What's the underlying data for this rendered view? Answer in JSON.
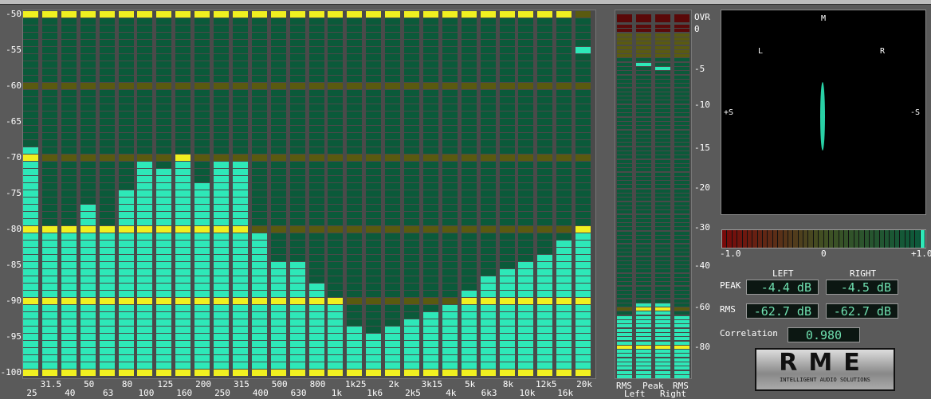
{
  "analyzer": {
    "y_labels": [
      "-50",
      "-55",
      "-60",
      "-65",
      "-70",
      "-75",
      "-80",
      "-85",
      "-90",
      "-95",
      "-100"
    ],
    "bands": [
      "25",
      "31.5",
      "40",
      "50",
      "63",
      "80",
      "100",
      "125",
      "160",
      "200",
      "250",
      "315",
      "400",
      "500",
      "630",
      "800",
      "1k",
      "1k25",
      "1k6",
      "2k",
      "2k5",
      "3k15",
      "4k",
      "5k",
      "6k3",
      "8k",
      "10k",
      "12k5",
      "16k",
      "20k"
    ],
    "levels_db": [
      -69,
      -80,
      -80,
      -77,
      -80,
      -75,
      -71,
      -72,
      -70,
      -74,
      -71,
      -71,
      -81,
      -85,
      -85,
      -88,
      -90,
      -94,
      -95,
      -94,
      -93,
      -92,
      -91,
      -89,
      -87,
      -86,
      -85,
      -84,
      -82,
      -80
    ],
    "peak_hold_db": [
      -50,
      -50,
      -50,
      -50,
      -50,
      -50,
      -50,
      -50,
      -50,
      -50,
      -50,
      -50,
      -50,
      -50,
      -50,
      -50,
      -50,
      -50,
      -50,
      -50,
      -50,
      -50,
      -50,
      -50,
      -50,
      -50,
      -50,
      -50,
      -50,
      -55
    ],
    "range_db": [
      -100,
      -50
    ]
  },
  "meters": {
    "scale": [
      "OVR",
      "0",
      "-5",
      "-10",
      "-15",
      "-20",
      "-30",
      "-40",
      "-60",
      "-80"
    ],
    "columns": [
      {
        "top": "RMS",
        "level_db": -62.7
      },
      {
        "top": "Peak",
        "level_db": -57,
        "peak_hold_db": -4.4
      },
      {
        "top": "Peak",
        "level_db": -57,
        "peak_hold_db": -4.5
      },
      {
        "top": "RMS",
        "level_db": -62.7
      }
    ],
    "bottom_labels": [
      "Left",
      "Right"
    ]
  },
  "goniometer": {
    "m": "M",
    "l": "L",
    "r": "R",
    "plus_s": "+S",
    "minus_s": "-S"
  },
  "correlation_bar": {
    "min": "-1.0",
    "mid": "0",
    "max": "+1.0",
    "value": 0.98
  },
  "readouts": {
    "left": "LEFT",
    "right": "RIGHT",
    "peak": "PEAK",
    "rms": "RMS",
    "peak_left": "-4.4 dB",
    "peak_right": "-4.5 dB",
    "rms_left": "-62.7 dB",
    "rms_right": "-62.7 dB",
    "correlation_label": "Correlation",
    "correlation_value": "0.980"
  },
  "logo": {
    "brand": "RME",
    "tagline": "INTELLIGENT AUDIO SOLUTIONS"
  },
  "colors": {
    "lit": "#2ee8b8",
    "unlit": "#0b5a3a",
    "marker_lit": "#f0f020",
    "marker_unlit": "#5a5a10",
    "red_unlit": "#5a0808"
  }
}
